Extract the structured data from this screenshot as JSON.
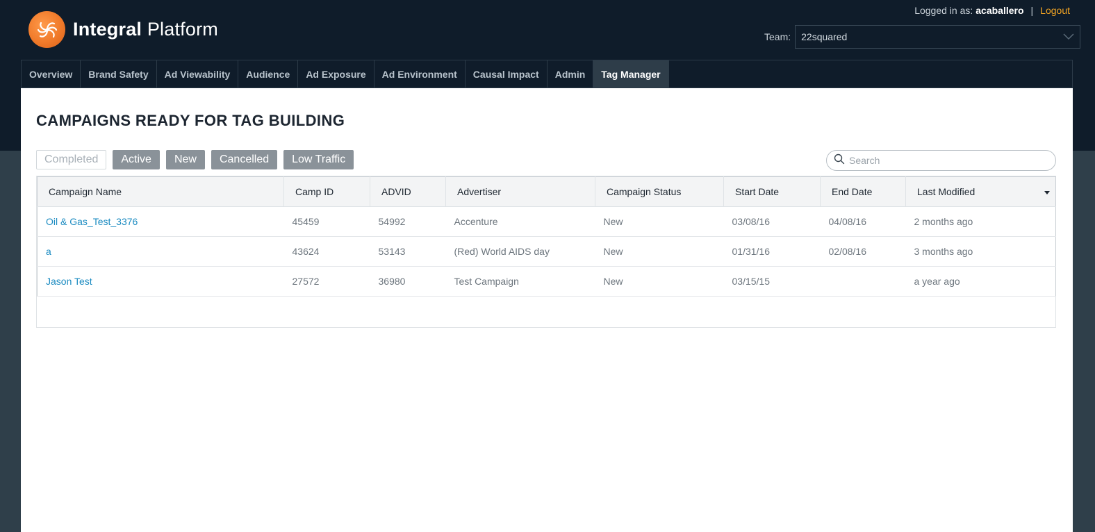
{
  "header": {
    "logo_bold": "Integral",
    "logo_light": "Platform",
    "logged_in_label": "Logged in as:",
    "username": "acaballero",
    "separator": "|",
    "logout_label": "Logout",
    "team_label": "Team:",
    "team_value": "22squared"
  },
  "nav": {
    "tabs": [
      {
        "label": "Overview"
      },
      {
        "label": "Brand Safety"
      },
      {
        "label": "Ad Viewability"
      },
      {
        "label": "Audience"
      },
      {
        "label": "Ad Exposure"
      },
      {
        "label": "Ad Environment"
      },
      {
        "label": "Causal Impact"
      },
      {
        "label": "Admin"
      },
      {
        "label": "Tag Manager",
        "active": true
      }
    ]
  },
  "main": {
    "title": "CAMPAIGNS READY FOR TAG BUILDING",
    "filters": [
      {
        "label": "Completed",
        "selected": false
      },
      {
        "label": "Active",
        "selected": true
      },
      {
        "label": "New",
        "selected": true
      },
      {
        "label": "Cancelled",
        "selected": true
      },
      {
        "label": "Low Traffic",
        "selected": true
      }
    ],
    "search_placeholder": "Search",
    "table": {
      "columns": [
        "Campaign Name",
        "Camp ID",
        "ADVID",
        "Advertiser",
        "Campaign Status",
        "Start Date",
        "End Date",
        "Last Modified"
      ],
      "rows": [
        [
          "Oil & Gas_Test_3376",
          "45459",
          "54992",
          "Accenture",
          "New",
          "03/08/16",
          "04/08/16",
          "2 months ago"
        ],
        [
          "a",
          "43624",
          "53143",
          "(Red) World AIDS day",
          "New",
          "01/31/16",
          "02/08/16",
          "3 months ago"
        ],
        [
          "Jason Test",
          "27572",
          "36980",
          "Test Campaign",
          "New",
          "03/15/15",
          "",
          "a year ago"
        ]
      ]
    }
  },
  "colors": {
    "header_bg": "#0f1c2a",
    "accent_link": "#1b8bc1",
    "logout": "#f5a623",
    "logo_orange": "#f07a2a"
  }
}
